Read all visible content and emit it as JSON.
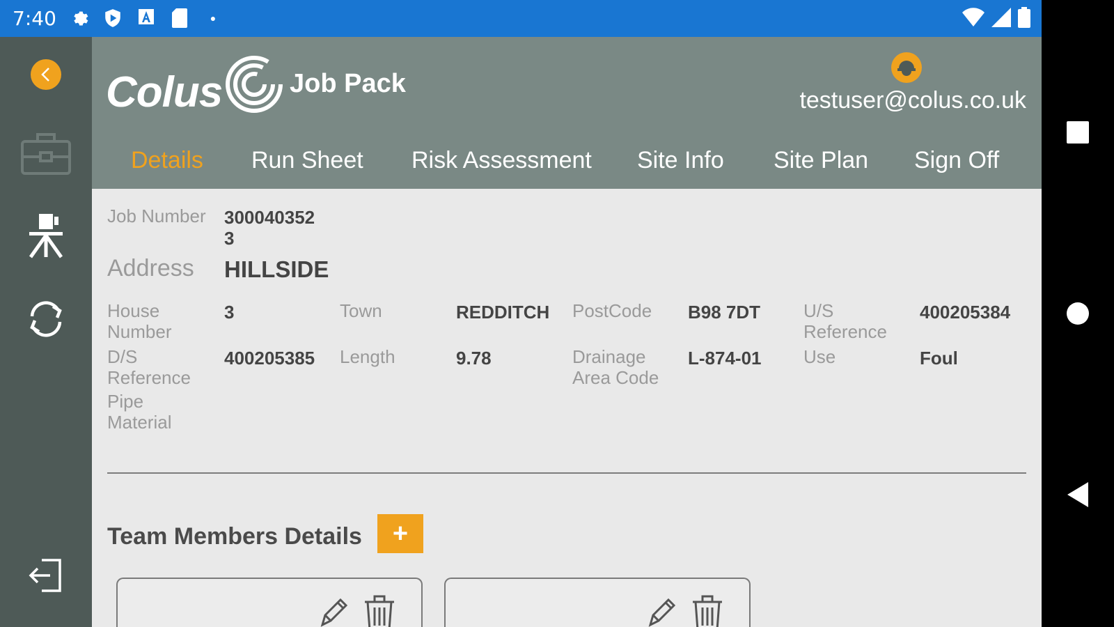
{
  "status_bar": {
    "time": "7:40",
    "left_icons": [
      "gear-icon",
      "shield-icon",
      "text-a-icon",
      "sd-card-icon",
      "dot-icon"
    ],
    "right_icons": [
      "wifi-icon",
      "signal-icon",
      "battery-icon"
    ],
    "color": "#1976d2"
  },
  "sidebar": {
    "items": [
      {
        "icon": "back-icon"
      },
      {
        "icon": "briefcase-icon"
      },
      {
        "icon": "survey-tripod-icon"
      },
      {
        "icon": "sync-icon"
      },
      {
        "icon": "logout-icon"
      }
    ]
  },
  "header": {
    "logo_text": "Colus",
    "app_title": "Job Pack",
    "user_email": "testuser@colus.co.uk",
    "accent": "#f0a21e"
  },
  "tabs": [
    {
      "label": "Details",
      "active": true
    },
    {
      "label": "Run Sheet"
    },
    {
      "label": "Risk Assessment"
    },
    {
      "label": "Site Info"
    },
    {
      "label": "Site Plan"
    },
    {
      "label": "Sign Off"
    }
  ],
  "details": {
    "job_number_label": "Job Number",
    "job_number_value_line1": "300040352",
    "job_number_value_line2": "3",
    "address_label": "Address",
    "address_value": "HILLSIDE",
    "house_number_label_1": "House",
    "house_number_label_2": "Number",
    "house_number_value": "3",
    "town_label": "Town",
    "town_value": "REDDITCH",
    "postcode_label": "PostCode",
    "postcode_value": "B98 7DT",
    "us_ref_label_1": "U/S",
    "us_ref_label_2": "Reference",
    "us_ref_value": "400205384",
    "ds_ref_label_1": "D/S",
    "ds_ref_label_2": "Reference",
    "ds_ref_value": "400205385",
    "length_label": "Length",
    "length_value": "9.78",
    "drainage_label_1": "Drainage",
    "drainage_label_2": "Area Code",
    "drainage_value": "L-874-01",
    "use_label": "Use",
    "use_value": "Foul",
    "pipe_label_1": "Pipe",
    "pipe_label_2": "Material"
  },
  "team": {
    "title": "Team Members Details",
    "add_label": "+",
    "cards": [
      {
        "edit_icon": "pencil-icon",
        "delete_icon": "trash-icon"
      },
      {
        "edit_icon": "pencil-icon",
        "delete_icon": "trash-icon"
      }
    ]
  },
  "nav_bar": {
    "buttons": [
      "recents-icon",
      "home-icon",
      "back-triangle-icon"
    ]
  }
}
